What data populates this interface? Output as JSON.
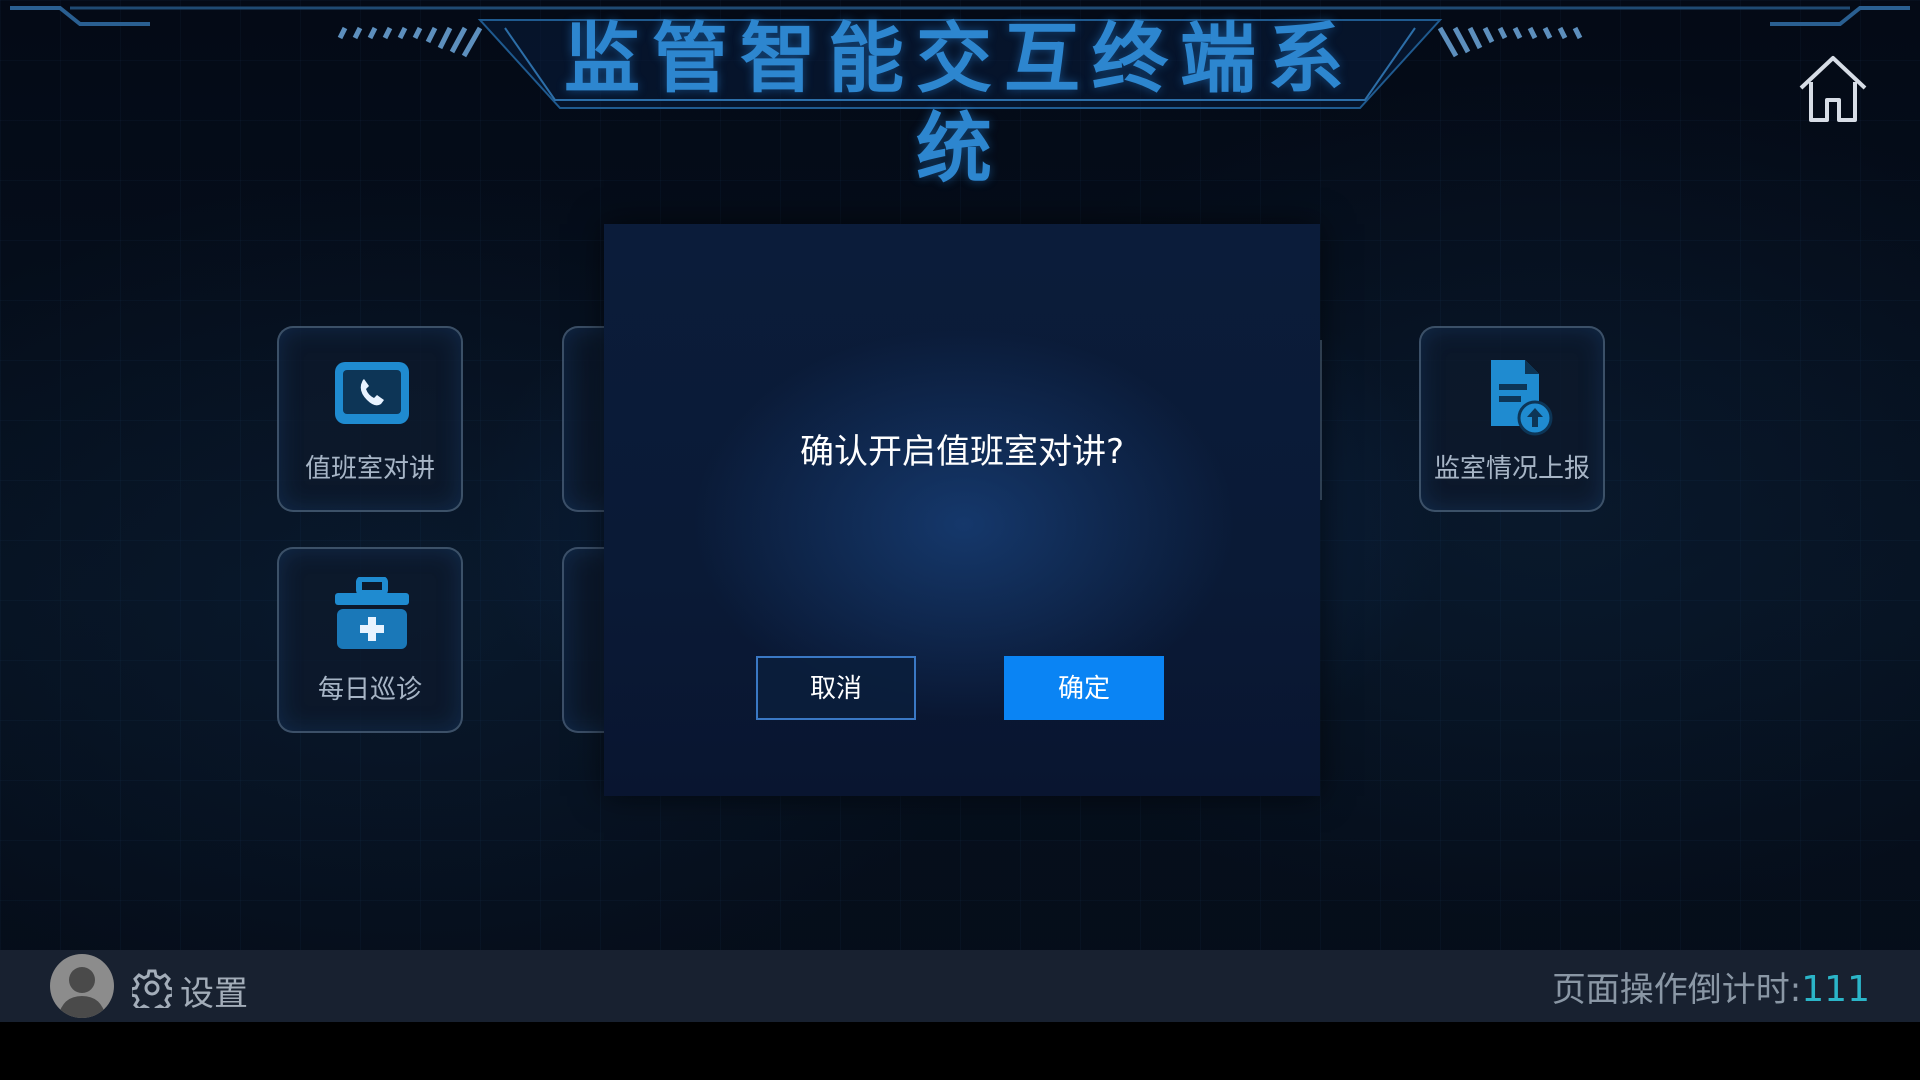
{
  "header": {
    "title": "监管智能交互终端系统",
    "home_icon": "home-icon"
  },
  "tiles": [
    {
      "label": "值班室对讲",
      "icon": "phone-icon"
    },
    {
      "label": "每日巡诊",
      "icon": "medical-kit-icon"
    },
    {
      "label": "监室情况上报",
      "icon": "document-upload-icon"
    }
  ],
  "dialog": {
    "message": "确认开启值班室对讲?",
    "cancel_label": "取消",
    "ok_label": "确定"
  },
  "bottom_bar": {
    "settings_label": "设置",
    "countdown_label": "页面操作倒计时:",
    "countdown_value": "111"
  },
  "colors": {
    "title": "#2d86cf",
    "ok_button": "#0a84f4",
    "countdown_value": "#2bb5c8",
    "bottom_bar": "#182130"
  }
}
